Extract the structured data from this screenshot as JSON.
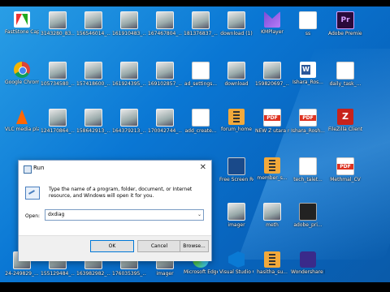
{
  "desktop": {
    "icons": [
      {
        "label": "FastStone Capture",
        "icon": "faststone"
      },
      {
        "label": "3143280_83...",
        "icon": "thumb"
      },
      {
        "label": "156546014_...",
        "icon": "thumb"
      },
      {
        "label": "161910483_...",
        "icon": "thumb"
      },
      {
        "label": "167467804_...",
        "icon": "thumb"
      },
      {
        "label": "181376837_...",
        "icon": "thumb"
      },
      {
        "label": "download (1)",
        "icon": "thumb"
      },
      {
        "label": "KMPlayer",
        "icon": "kmp"
      },
      {
        "label": "ss",
        "icon": "icon-blank"
      },
      {
        "label": "Adobe Premiere P...",
        "icon": "pr"
      },
      {
        "label": "Google Chrome",
        "icon": "chrome"
      },
      {
        "label": "105734580_...",
        "icon": "thumb"
      },
      {
        "label": "157418600_...",
        "icon": "thumb"
      },
      {
        "label": "161924395_...",
        "icon": "thumb"
      },
      {
        "label": "169102857_...",
        "icon": "thumb"
      },
      {
        "label": "ad_settings...",
        "icon": "settings"
      },
      {
        "label": "download",
        "icon": "thumb"
      },
      {
        "label": "159820697_...",
        "icon": "thumb"
      },
      {
        "label": "Ishara_Ros...",
        "icon": "word"
      },
      {
        "label": "daily_task_...",
        "icon": "doc"
      },
      {
        "label": "VLC media player",
        "icon": "vlc"
      },
      {
        "label": "124170864_...",
        "icon": "thumb"
      },
      {
        "label": "158642913_...",
        "icon": "thumb"
      },
      {
        "label": "164379213_...",
        "icon": "thumb"
      },
      {
        "label": "170042744_...",
        "icon": "thumb"
      },
      {
        "label": "add_create...",
        "icon": "settings"
      },
      {
        "label": "forum_home",
        "icon": "sub"
      },
      {
        "label": "NEW Z utara methmal C...",
        "icon": "pdf"
      },
      {
        "label": "Ishara_Rosh...",
        "icon": "pdf"
      },
      {
        "label": "FileZilla Client",
        "icon": "fz"
      },
      {
        "label": "Free Screen Recorder ...",
        "icon": "ffree"
      },
      {
        "label": "member_s...",
        "icon": "sub"
      },
      {
        "label": "tech_talet...",
        "icon": "doc"
      },
      {
        "label": "Methmal_CV",
        "icon": "pdf"
      },
      {
        "label": "imager",
        "icon": "thumb"
      },
      {
        "label": "meth",
        "icon": "thumb"
      },
      {
        "label": "adobe_pri...",
        "icon": "dark"
      },
      {
        "label": "24-249829_...",
        "icon": "thumb"
      },
      {
        "label": "155129484_...",
        "icon": "thumb"
      },
      {
        "label": "163982982_...",
        "icon": "thumb"
      },
      {
        "label": "176035395_...",
        "icon": "thumb"
      },
      {
        "label": "imager",
        "icon": "thumb"
      },
      {
        "label": "Microsoft Edge",
        "icon": "edge"
      },
      {
        "label": "Visual Studio Code",
        "icon": "vs"
      },
      {
        "label": "hasitha_su...",
        "icon": "sub"
      },
      {
        "label": "Wondershare DemoCreator",
        "icon": "wonder"
      }
    ]
  },
  "run_dialog": {
    "title": "Run",
    "close_glyph": "✕",
    "description": "Type the name of a program, folder, document, or Internet resource, and Windows will open it for you.",
    "open_label": "Open:",
    "open_value": "dxdiag",
    "dropdown_glyph": "⌄",
    "ok_label": "OK",
    "cancel_label": "Cancel",
    "browse_label": "Browse..."
  }
}
